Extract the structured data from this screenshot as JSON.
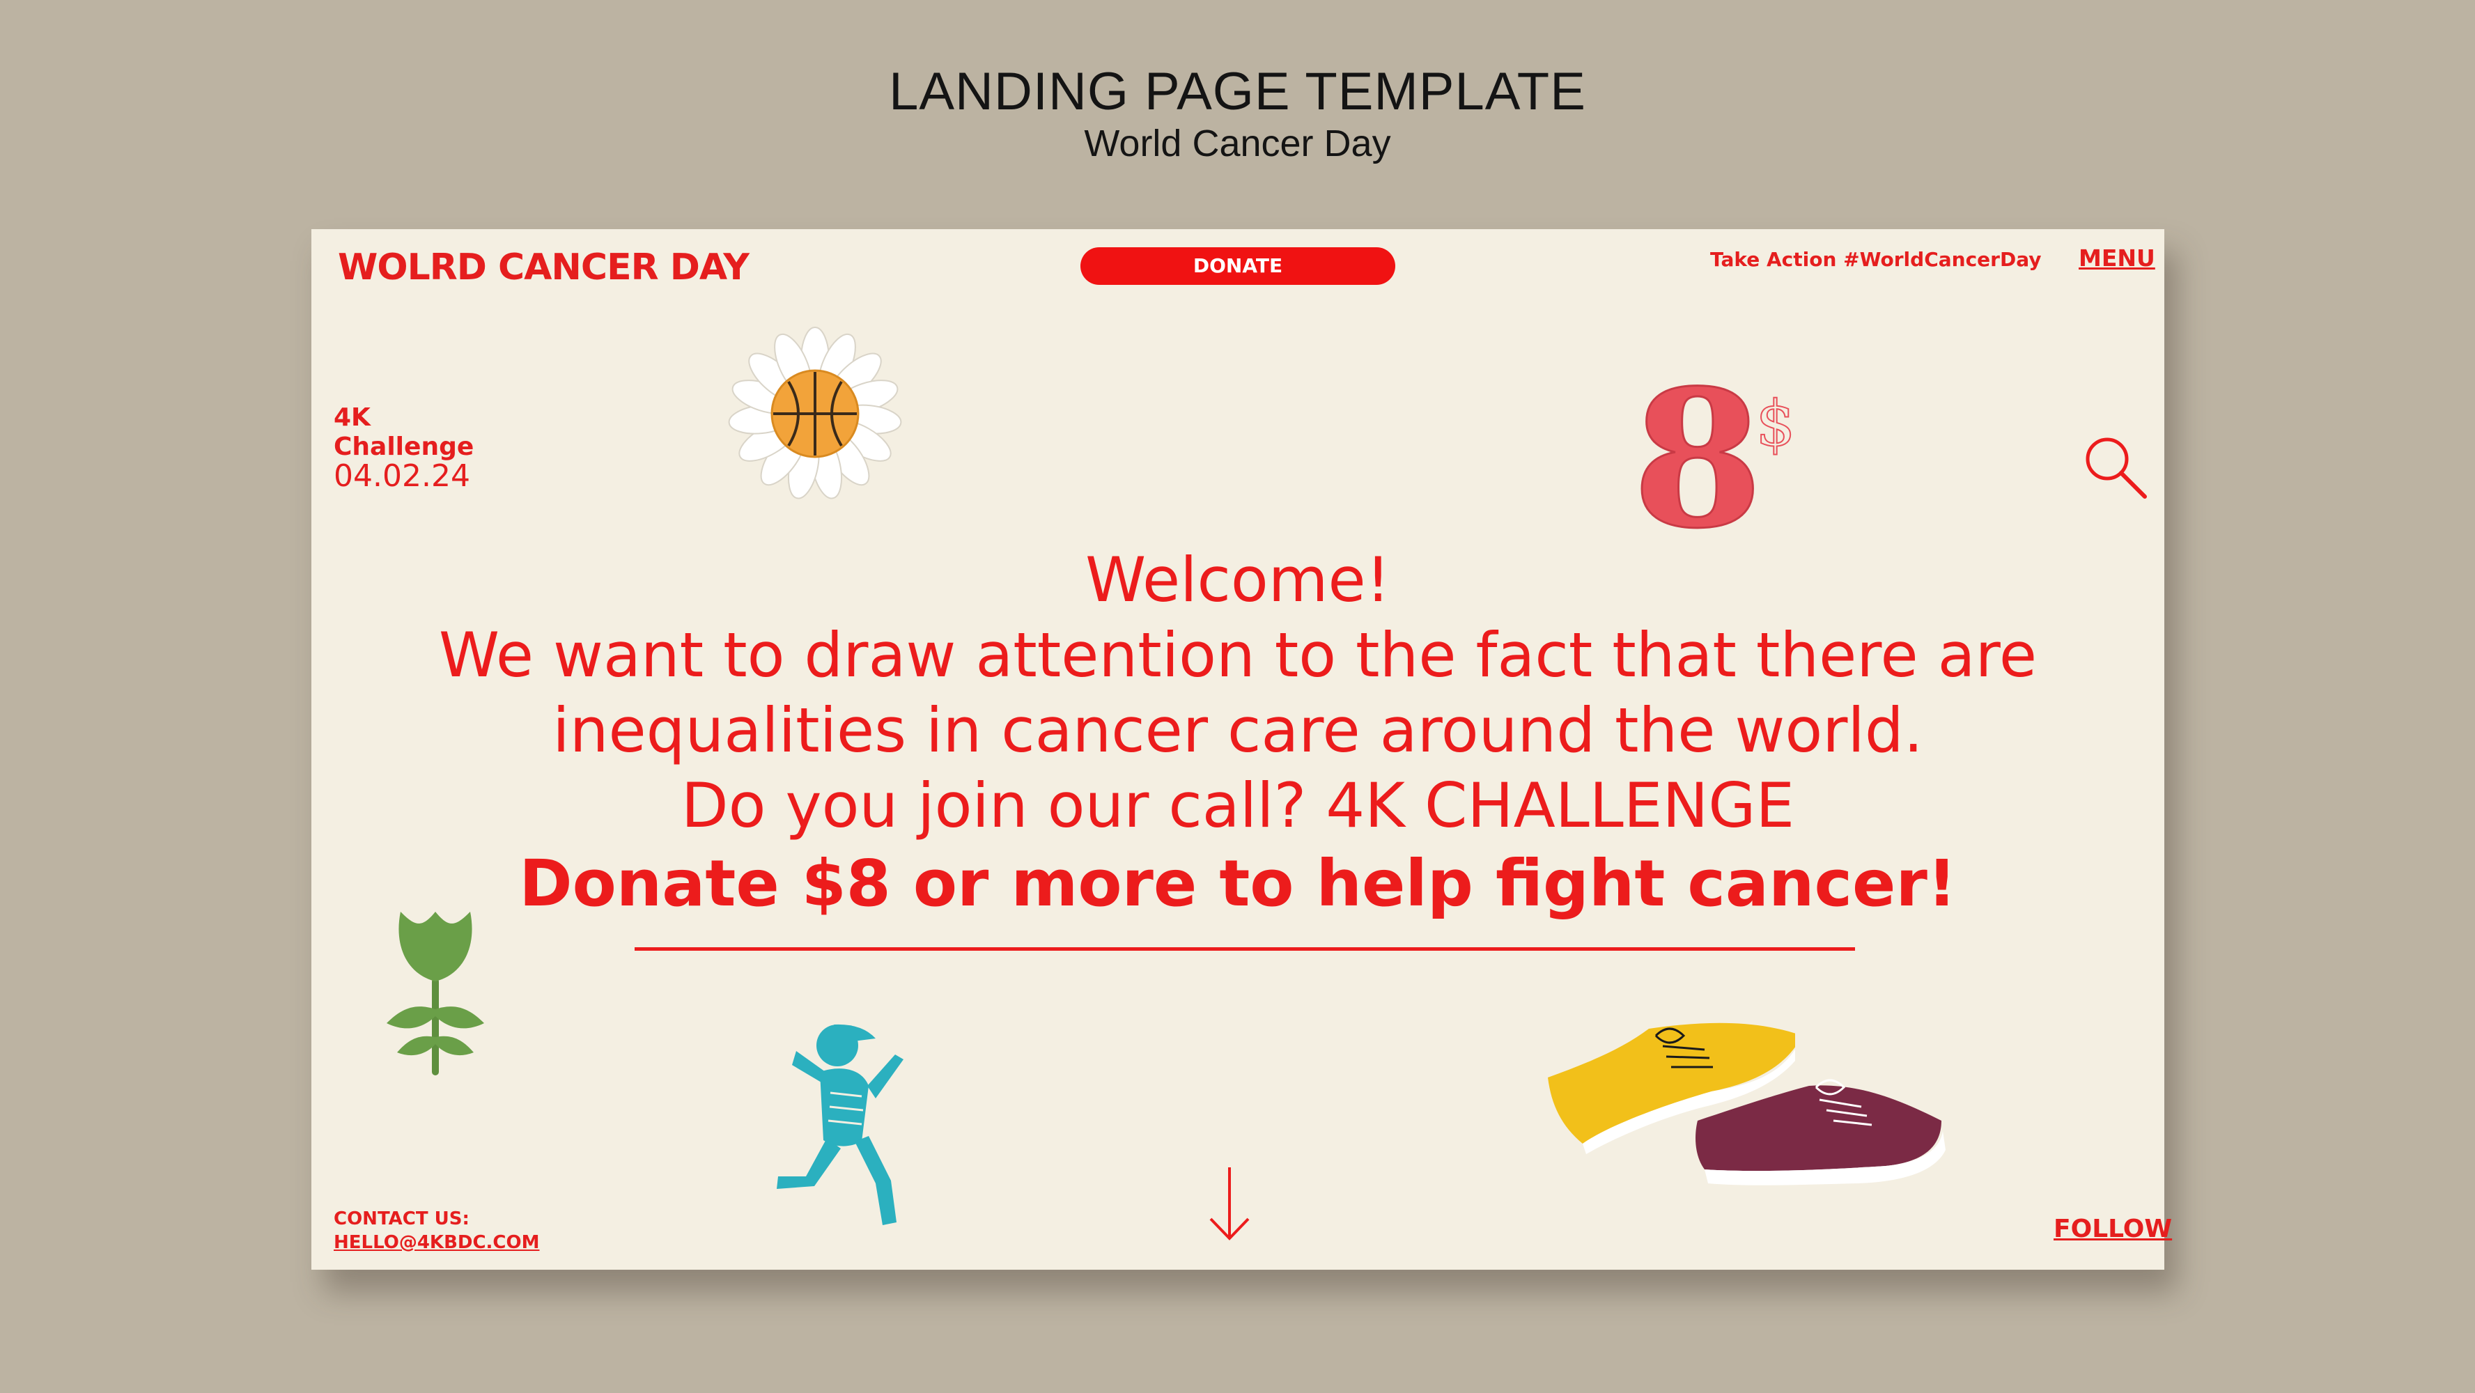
{
  "header": {
    "title": "LANDING PAGE TEMPLATE",
    "subtitle": "World Cancer Day"
  },
  "nav": {
    "brand": "WOLRD CANCER DAY",
    "donate_label": "DONATE",
    "take_action": "Take Action #WorldCancerDay",
    "menu_label": "MENU"
  },
  "challenge": {
    "line1": "4K",
    "line2": "Challenge",
    "date": "04.02.24"
  },
  "hero": {
    "line1": "Welcome!",
    "line2": "We want to draw attention to the fact that there are",
    "line3": "inequalities in cancer care around the world.",
    "line4": "Do you join our call? 4K CHALLENGE",
    "callout": "Donate $8 or more to help fight cancer!"
  },
  "price_sticker": {
    "number": "8",
    "currency": "$"
  },
  "footer": {
    "contact_label": "CONTACT US:",
    "email": "HELLO@4KBDC.COM",
    "follow_label": "FOLLOW"
  },
  "icons": {
    "search": "search-icon",
    "arrow": "arrow-down-icon",
    "flower": "daisy-basketball-icon",
    "leaf": "leaf-plant-icon",
    "runner": "runner-figure-icon",
    "shoes": "sneakers-icon"
  },
  "colors": {
    "accent": "#ec1c1c",
    "page_bg": "#f4efe2",
    "outer_bg": "#bcb3a2"
  }
}
